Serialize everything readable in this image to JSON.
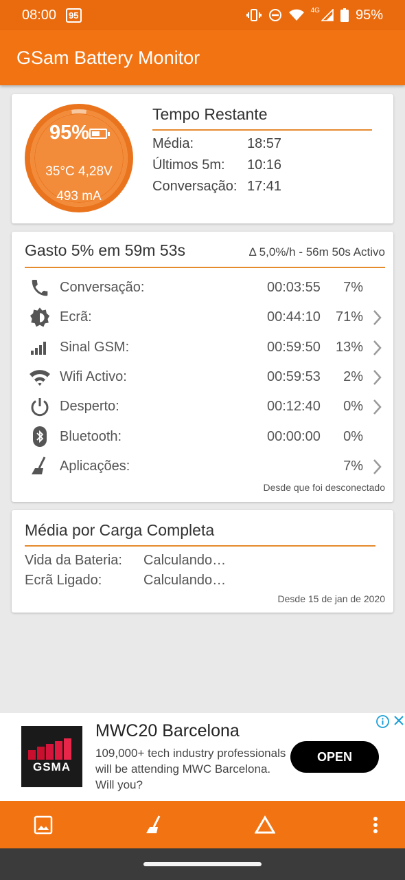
{
  "status_bar": {
    "time": "08:00",
    "badge": "95",
    "network": "4G",
    "battery": "95%"
  },
  "app": {
    "title": "GSam Battery Monitor"
  },
  "summary": {
    "percent": "95%",
    "temp_volt": "35°C  4,28V",
    "current": "493 mA",
    "gauge_level": 0.95
  },
  "remaining": {
    "title": "Tempo Restante",
    "rows": [
      {
        "label": "Média:",
        "value": "18:57"
      },
      {
        "label": "Últimos 5m:",
        "value": "10:16"
      },
      {
        "label": "Conversação:",
        "value": "17:41"
      }
    ]
  },
  "usage": {
    "title": "Gasto 5% em 59m 53s",
    "subtitle": "Δ 5,0%/h - 56m 50s Activo",
    "items": [
      {
        "icon": "phone-icon",
        "label": "Conversação:",
        "time": "00:03:55",
        "pct": "7%"
      },
      {
        "icon": "screen-brightness-icon",
        "label": "Ecrã:",
        "time": "00:44:10",
        "pct": "71%"
      },
      {
        "icon": "signal-icon",
        "label": "Sinal GSM:",
        "time": "00:59:50",
        "pct": "13%"
      },
      {
        "icon": "wifi-icon",
        "label": "Wifi Activo:",
        "time": "00:59:53",
        "pct": "2%"
      },
      {
        "icon": "power-icon",
        "label": "Desperto:",
        "time": "00:12:40",
        "pct": "0%"
      },
      {
        "icon": "bluetooth-icon",
        "label": "Bluetooth:",
        "time": "00:00:00",
        "pct": "0%"
      },
      {
        "icon": "broom-icon",
        "label": "Aplicações:",
        "time": "",
        "pct": "7%"
      }
    ],
    "footer": "Desde que foi desconectado"
  },
  "full_charge": {
    "title": "Média por Carga Completa",
    "rows": [
      {
        "label": "Vida da Bateria:",
        "value": "Calculando…"
      },
      {
        "label": "Ecrã Ligado:",
        "value": "Calculando…"
      }
    ],
    "footer": "Desde 15 de jan de 2020"
  },
  "ad": {
    "logo_text": "GSMA",
    "title": "MWC20 Barcelona",
    "description": "109,000+ tech industry professionals will be attending MWC Barcelona. Will you?",
    "button": "OPEN"
  },
  "bottom_bar": [
    "image-icon",
    "broom-icon",
    "triangle-icon",
    "more-vert-icon"
  ],
  "colors": {
    "orange": "#f27312",
    "status_orange": "#ea6b0e",
    "divider": "#e68a2e"
  }
}
